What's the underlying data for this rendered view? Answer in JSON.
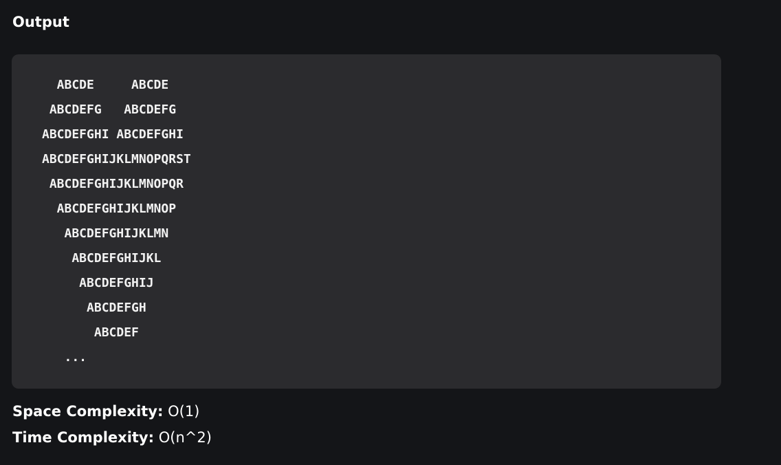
{
  "heading": "Output",
  "output_lines": [
    "  ABCDE     ABCDE",
    " ABCDEFG   ABCDEFG",
    "ABCDEFGHI ABCDEFGHI",
    "ABCDEFGHIJKLMNOPQRST",
    " ABCDEFGHIJKLMNOPQR",
    "  ABCDEFGHIJKLMNOP",
    "   ABCDEFGHIJKLMN",
    "    ABCDEFGHIJKL",
    "     ABCDEFGHIJ",
    "      ABCDEFGH",
    "       ABCDEF",
    "   ..."
  ],
  "space_complexity": {
    "label": "Space Complexity:",
    "value": "O(1)"
  },
  "time_complexity": {
    "label": "Time Complexity:",
    "value": "O(n^2)"
  }
}
